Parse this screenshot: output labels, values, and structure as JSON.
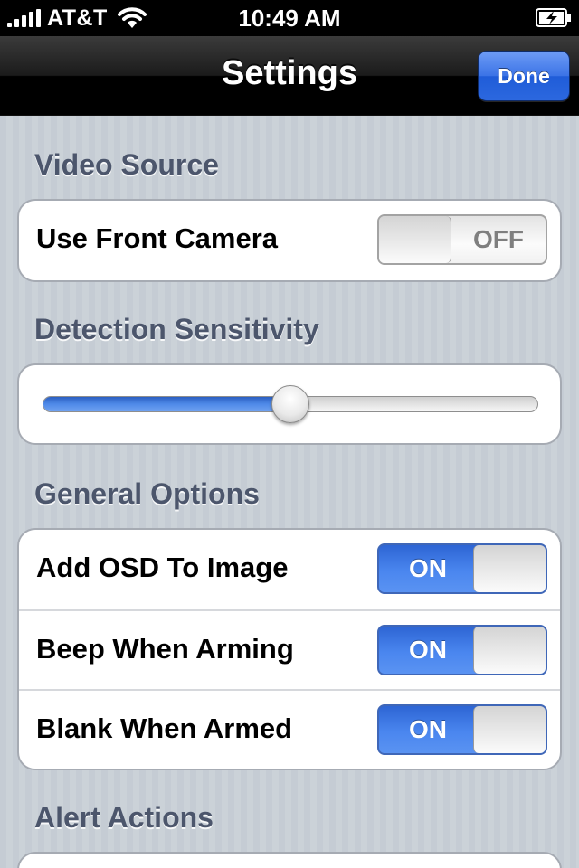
{
  "status_bar": {
    "carrier": "AT&T",
    "time": "10:49 AM",
    "icons": [
      "signal-bars-icon",
      "wifi-icon",
      "battery-charging-icon"
    ]
  },
  "nav": {
    "title": "Settings",
    "done_label": "Done",
    "accent_color": "#2c68df"
  },
  "sections": {
    "video_source": {
      "header": "Video Source",
      "rows": [
        {
          "label": "Use Front Camera",
          "state": "OFF"
        }
      ]
    },
    "detection_sensitivity": {
      "header": "Detection Sensitivity",
      "slider_value": 0.5
    },
    "general_options": {
      "header": "General Options",
      "rows": [
        {
          "label": "Add OSD To Image",
          "state": "ON"
        },
        {
          "label": "Beep When Arming",
          "state": "ON"
        },
        {
          "label": "Blank When Armed",
          "state": "ON"
        }
      ]
    },
    "alert_actions": {
      "header": "Alert Actions"
    }
  }
}
